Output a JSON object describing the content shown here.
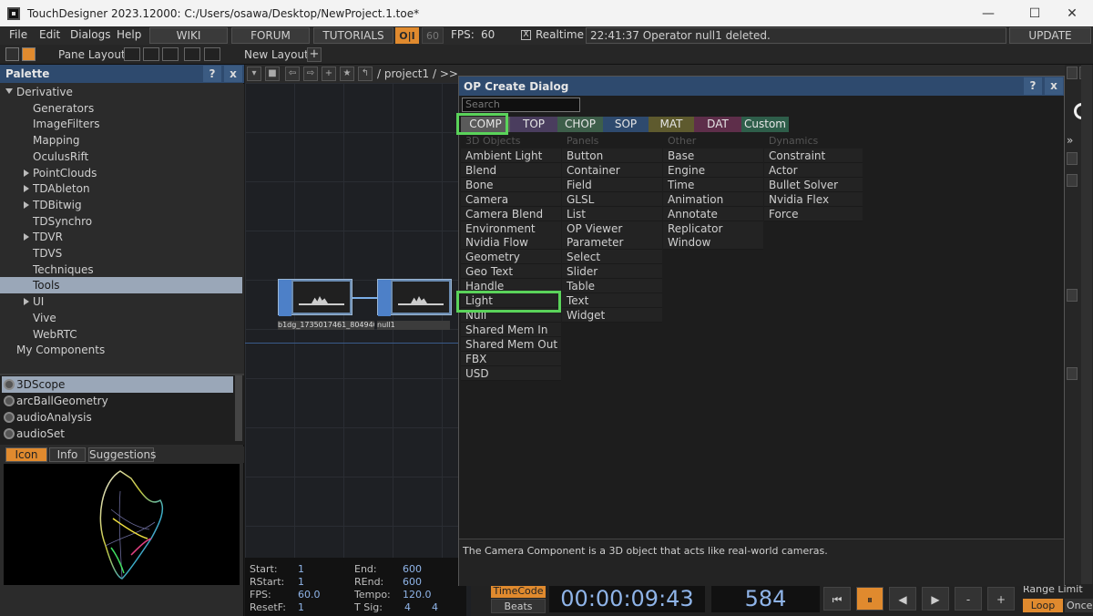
{
  "window": {
    "title": "TouchDesigner 2023.12000: C:/Users/osawa/Desktop/NewProject.1.toe*",
    "controls": [
      "—",
      "☐",
      "✕"
    ]
  },
  "menubar": {
    "items": [
      "File",
      "Edit",
      "Dialogs",
      "Help"
    ],
    "buttons": [
      "WIKI",
      "FORUM",
      "TUTORIALS"
    ],
    "oi": "O|I",
    "fps_target": "60",
    "fps_label": "FPS:",
    "fps_value": "60",
    "realtime_label": "Realtime",
    "realtime_checked": "X",
    "status": "22:41:37 Operator null1 deleted.",
    "update": "UPDATE"
  },
  "panebar": {
    "pane_layout": "Pane Layout",
    "new_layout": "New Layout",
    "add": "+"
  },
  "palette": {
    "title": "Palette",
    "help": "?",
    "close": "x",
    "tree": [
      {
        "label": "Derivative",
        "indent": 0,
        "expander": "down"
      },
      {
        "label": "Generators",
        "indent": 2,
        "expander": ""
      },
      {
        "label": "ImageFilters",
        "indent": 2,
        "expander": ""
      },
      {
        "label": "Mapping",
        "indent": 2,
        "expander": ""
      },
      {
        "label": "OculusRift",
        "indent": 2,
        "expander": ""
      },
      {
        "label": "PointClouds",
        "indent": 2,
        "expander": "right"
      },
      {
        "label": "TDAbleton",
        "indent": 2,
        "expander": "right"
      },
      {
        "label": "TDBitwig",
        "indent": 2,
        "expander": "right"
      },
      {
        "label": "TDSynchro",
        "indent": 2,
        "expander": ""
      },
      {
        "label": "TDVR",
        "indent": 2,
        "expander": "right"
      },
      {
        "label": "TDVS",
        "indent": 2,
        "expander": ""
      },
      {
        "label": "Techniques",
        "indent": 2,
        "expander": ""
      },
      {
        "label": "Tools",
        "indent": 2,
        "expander": "",
        "selected": true
      },
      {
        "label": "UI",
        "indent": 2,
        "expander": "right"
      },
      {
        "label": "Vive",
        "indent": 2,
        "expander": ""
      },
      {
        "label": "WebRTC",
        "indent": 2,
        "expander": ""
      },
      {
        "label": "My Components",
        "indent": 1,
        "expander": ""
      }
    ],
    "components": [
      {
        "label": "3DScope",
        "selected": true
      },
      {
        "label": "arcBallGeometry"
      },
      {
        "label": "audioAnalysis"
      },
      {
        "label": "audioSet"
      }
    ],
    "info_tabs": [
      "Icon",
      "Info",
      "Suggestions"
    ]
  },
  "network": {
    "path": "/ project1 / >>",
    "nodes": [
      {
        "label": "b1dg_1735017461_804940"
      },
      {
        "label": "null1"
      }
    ]
  },
  "timebar": {
    "rows": [
      {
        "l1": "Start:",
        "v1": "1",
        "l2": "End:",
        "v2": "600"
      },
      {
        "l1": "RStart:",
        "v1": "1",
        "l2": "REnd:",
        "v2": "600"
      },
      {
        "l1": "FPS:",
        "v1": "60.0",
        "l2": "Tempo:",
        "v2": "120.0"
      },
      {
        "l1": "ResetF:",
        "v1": "1",
        "l2": "T Sig:",
        "v2": "4",
        "v3": "4"
      }
    ],
    "timecode_btn": "TimeCode",
    "beats_btn": "Beats",
    "timecode": "00:00:09:43",
    "frame": "584",
    "range_limit": "Range Limit",
    "loop": "Loop",
    "once": "Once"
  },
  "dialog": {
    "title": "OP Create Dialog",
    "help": "?",
    "close": "x",
    "search_placeholder": "Search",
    "families": [
      {
        "label": "COMP",
        "color": "#5a5a5a"
      },
      {
        "label": "TOP",
        "color": "#4a3d5e"
      },
      {
        "label": "CHOP",
        "color": "#3d5e4a"
      },
      {
        "label": "SOP",
        "color": "#2e4a6e"
      },
      {
        "label": "MAT",
        "color": "#5e5a2e"
      },
      {
        "label": "DAT",
        "color": "#5e2e4a"
      },
      {
        "label": "Custom",
        "color": "#2e5e4a"
      }
    ],
    "columns": [
      {
        "header": "3D Objects",
        "items": [
          "Ambient Light",
          "Blend",
          "Bone",
          "Camera",
          "Camera Blend",
          "Environment Light",
          "Nvidia Flow Emitter",
          "Geometry",
          "Geo Text",
          "Handle",
          "Light",
          "Null",
          "Shared Mem In",
          "Shared Mem Out",
          "FBX",
          "USD"
        ]
      },
      {
        "header": "Panels",
        "items": [
          "Button",
          "Container",
          "Field",
          "GLSL",
          "List",
          "OP Viewer",
          "Parameter",
          "Select",
          "Slider",
          "Table",
          "Text",
          "Widget"
        ]
      },
      {
        "header": "Other",
        "items": [
          "Base",
          "Engine",
          "Time",
          "Animation",
          "Annotate",
          "Replicator",
          "Window"
        ]
      },
      {
        "header": "Dynamics",
        "items": [
          "Constraint",
          "Actor",
          "Bullet Solver",
          "Nvidia Flex Solver",
          "Force"
        ]
      }
    ],
    "description": "The Camera Component is a 3D object that acts like real-world cameras."
  },
  "colors": {
    "accent_orange": "#e08a2e",
    "highlight_green": "#5ad35a",
    "panel_blue": "#2e4a6e"
  }
}
